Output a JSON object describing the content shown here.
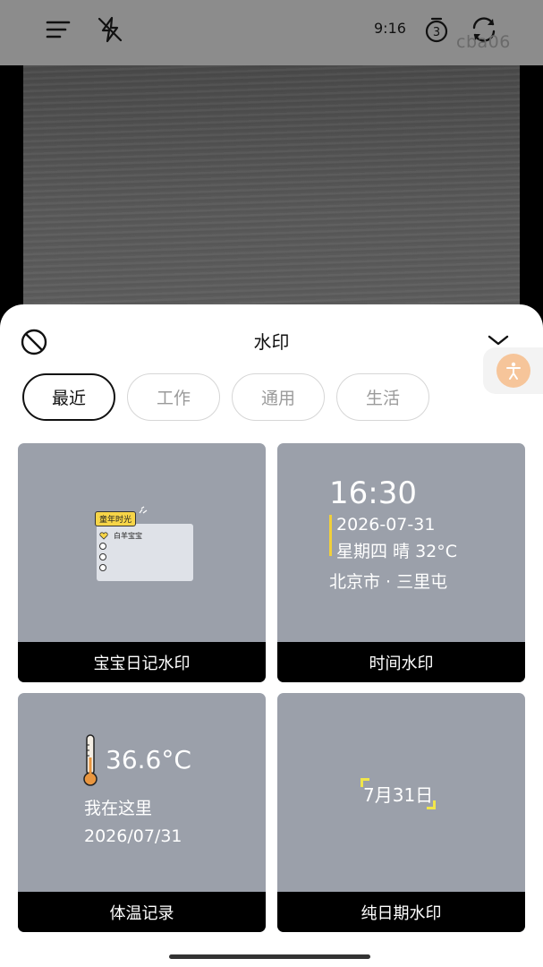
{
  "status_bar": {
    "time": "9:16",
    "overlay_text": "cba06",
    "menu_icon": "menu-icon",
    "flash_icon": "flash-off-icon",
    "timer_icon": "timer-3-icon",
    "switch_icon": "camera-switch-icon"
  },
  "sheet": {
    "title": "水印",
    "disable_icon": "ban-icon",
    "collapse_icon": "chevron-down-icon",
    "accessibility_icon": "accessibility-icon"
  },
  "tabs": [
    "最近",
    "工作",
    "通用",
    "生活"
  ],
  "active_tab": 0,
  "cards": [
    {
      "label": "宝宝日记水印",
      "preview": {
        "tag": "童年时光",
        "first_row": "白羊宝宝"
      }
    },
    {
      "label": "时间水印",
      "preview": {
        "time": "16:30",
        "date": "2026-07-31",
        "weather": "星期四 晴 32°C",
        "location": "北京市 · 三里屯"
      }
    },
    {
      "label": "体温记录",
      "preview": {
        "temperature": "36.6°C",
        "place": "我在这里",
        "date": "2026/07/31"
      }
    },
    {
      "label": "纯日期水印",
      "preview": {
        "date": "7月31日"
      }
    }
  ],
  "colors": {
    "card_bg": "#9ba0aa",
    "accent_yellow": "#f1d03a",
    "float_button": "#f6c59a"
  }
}
